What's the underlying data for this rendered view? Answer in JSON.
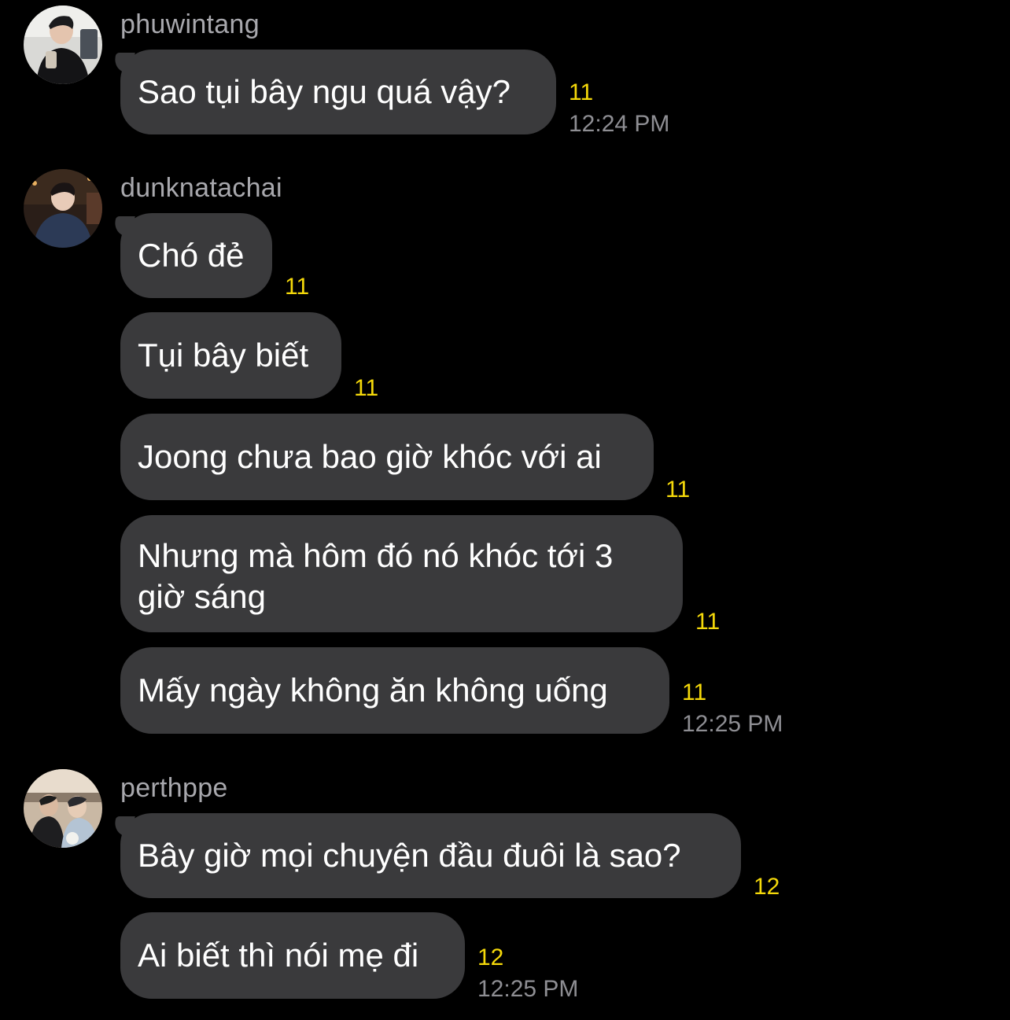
{
  "colors": {
    "background": "#000000",
    "bubble": "#3a3a3c",
    "sender_name": "#a8a8ad",
    "read_count": "#f5d90a",
    "timestamp": "#8e8e93"
  },
  "groups": [
    {
      "sender": "phuwintang",
      "avatar_icon": "profile-photo",
      "messages": [
        {
          "text": "Sao tụi bây ngu quá vậy?",
          "count": "11"
        }
      ],
      "time": "12:24 PM"
    },
    {
      "sender": "dunknatachai",
      "avatar_icon": "profile-photo",
      "messages": [
        {
          "text": "Chó đẻ",
          "count": "11"
        },
        {
          "text": "Tụi bây biết",
          "count": "11"
        },
        {
          "text": "Joong chưa bao giờ khóc với ai",
          "count": "11"
        },
        {
          "text": "Nhưng mà hôm đó nó khóc tới 3 giờ sáng",
          "count": "11"
        },
        {
          "text": "Mấy ngày không ăn không uống",
          "count": "11"
        }
      ],
      "time": "12:25 PM"
    },
    {
      "sender": "perthppe",
      "avatar_icon": "profile-photo",
      "messages": [
        {
          "text": "Bây giờ mọi chuyện đầu đuôi là sao?",
          "count": "12"
        },
        {
          "text": "Ai biết thì nói mẹ đi",
          "count": "12"
        }
      ],
      "time": "12:25 PM"
    }
  ]
}
